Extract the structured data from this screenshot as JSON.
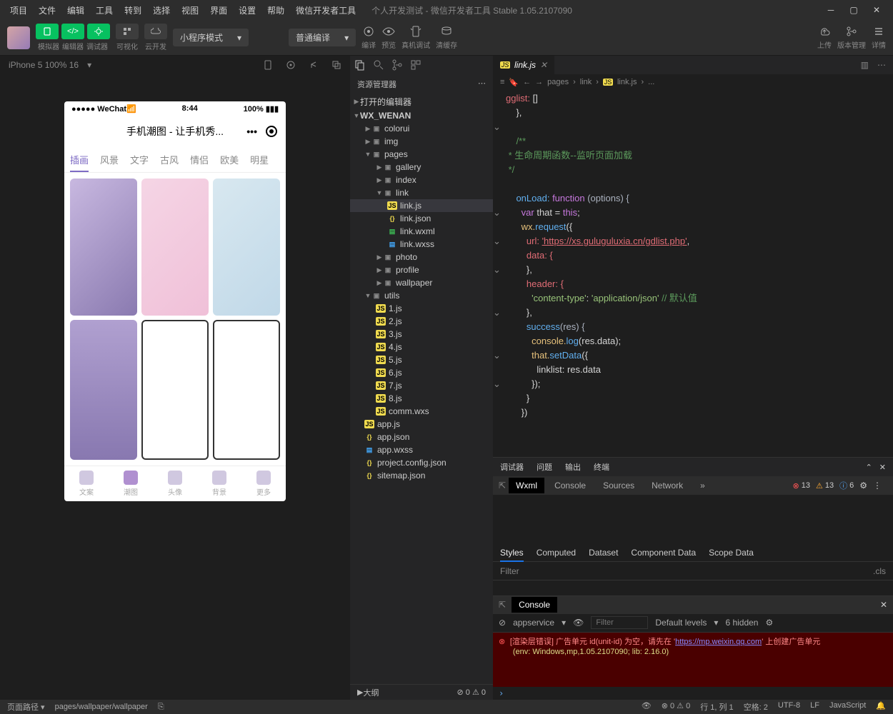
{
  "menu": [
    "项目",
    "文件",
    "编辑",
    "工具",
    "转到",
    "选择",
    "视图",
    "界面",
    "设置",
    "帮助",
    "微信开发者工具"
  ],
  "window_title": "个人开发测试 - 微信开发者工具 Stable 1.05.2107090",
  "toolbar": {
    "labels": [
      "模拟器",
      "编辑器",
      "调试器",
      "可视化",
      "云开发"
    ],
    "mode": "小程序模式",
    "compile": "普通编译",
    "actions": {
      "compile": "编译",
      "preview": "预览",
      "remote": "真机调试",
      "clear": "清缓存"
    },
    "right": {
      "upload": "上传",
      "version": "版本管理",
      "detail": "详情"
    }
  },
  "sim": {
    "device": "iPhone 5 100% 16"
  },
  "phone": {
    "carrier": "WeChat",
    "time": "8:44",
    "battery": "100%",
    "title": "手机潮图 - 让手机秀...",
    "tabs": [
      "插画",
      "风景",
      "文字",
      "古风",
      "情侣",
      "欧美",
      "明星"
    ],
    "tabbar": [
      "文案",
      "潮图",
      "头像",
      "背景",
      "更多"
    ]
  },
  "explorer": {
    "title": "资源管理器",
    "sections": {
      "opened": "打开的编辑器",
      "project": "WX_WENAN",
      "outline": "大纲"
    },
    "tree": {
      "colorui": "colorui",
      "img": "img",
      "pages": "pages",
      "gallery": "gallery",
      "index": "index",
      "link": "link",
      "linkjs": "link.js",
      "linkjson": "link.json",
      "linkwxml": "link.wxml",
      "linkwxss": "link.wxss",
      "photo": "photo",
      "profile": "profile",
      "wallpaper": "wallpaper",
      "utils": "utils",
      "u1": "1.js",
      "u2": "2.js",
      "u3": "3.js",
      "u4": "4.js",
      "u5": "5.js",
      "u6": "6.js",
      "u7": "7.js",
      "u8": "8.js",
      "commwxs": "comm.wxs",
      "appjs": "app.js",
      "appjson": "app.json",
      "appwxss": "app.wxss",
      "projectconfig": "project.config.json",
      "sitemap": "sitemap.json"
    }
  },
  "editor": {
    "tab": "link.js",
    "breadcrumb": [
      "pages",
      "link",
      "link.js",
      "..."
    ],
    "code_prop": "gglist: ",
    "code_comment1": "/**",
    "code_comment2": " * 生命周期函数--监听页面加载",
    "code_comment3": " */",
    "code_onload": "onLoad: ",
    "code_func": "function ",
    "code_opts": "(options) {",
    "code_var": "var ",
    "code_that": "that = ",
    "code_this": "this",
    "code_wx": "wx.",
    "code_req": "request",
    "code_url": "url: ",
    "code_urlval": "'https://xs.guluguluxia.cn/gdlist.php'",
    "code_data": "data: {",
    "code_header": "header: {",
    "code_ct": "'content-type'",
    "code_app": "'application/json'",
    "code_def": " // 默认值",
    "code_success": "success",
    "code_res": "(res) {",
    "code_log": "console.",
    "code_logfn": "log",
    "code_resdata": "(res.data);",
    "code_setdata": "that.",
    "code_setfn": "setData",
    "code_linklist": "linklist: res.data"
  },
  "debug": {
    "tabs": [
      "调试器",
      "问题",
      "输出",
      "终端"
    ],
    "devtabs": [
      "Wxml",
      "Console",
      "Sources",
      "Network"
    ],
    "counts": {
      "err": "13",
      "warn": "13",
      "info": "6"
    },
    "styletabs": [
      "Styles",
      "Computed",
      "Dataset",
      "Component Data",
      "Scope Data"
    ],
    "filter": "Filter",
    "cls": ".cls",
    "console": "Console",
    "context": "appservice",
    "levels": "Default levels",
    "hidden": "6 hidden",
    "err_text": "[渲染层错误] 广告单元 id(unit-id) 为空，请先在 '",
    "err_link": "https://mp.weixin.qq.com",
    "err_text2": "' 上创建广告单元",
    "err_env": "(env: Windows,mp,1.05.2107090; lib: 2.16.0)"
  },
  "status": {
    "pathlbl": "页面路径",
    "path": "pages/wallpaper/wallpaper",
    "err": "0",
    "warn": "0",
    "pos": "行 1, 列 1",
    "spaces": "空格: 2",
    "enc": "UTF-8",
    "eol": "LF",
    "lang": "JavaScript"
  }
}
